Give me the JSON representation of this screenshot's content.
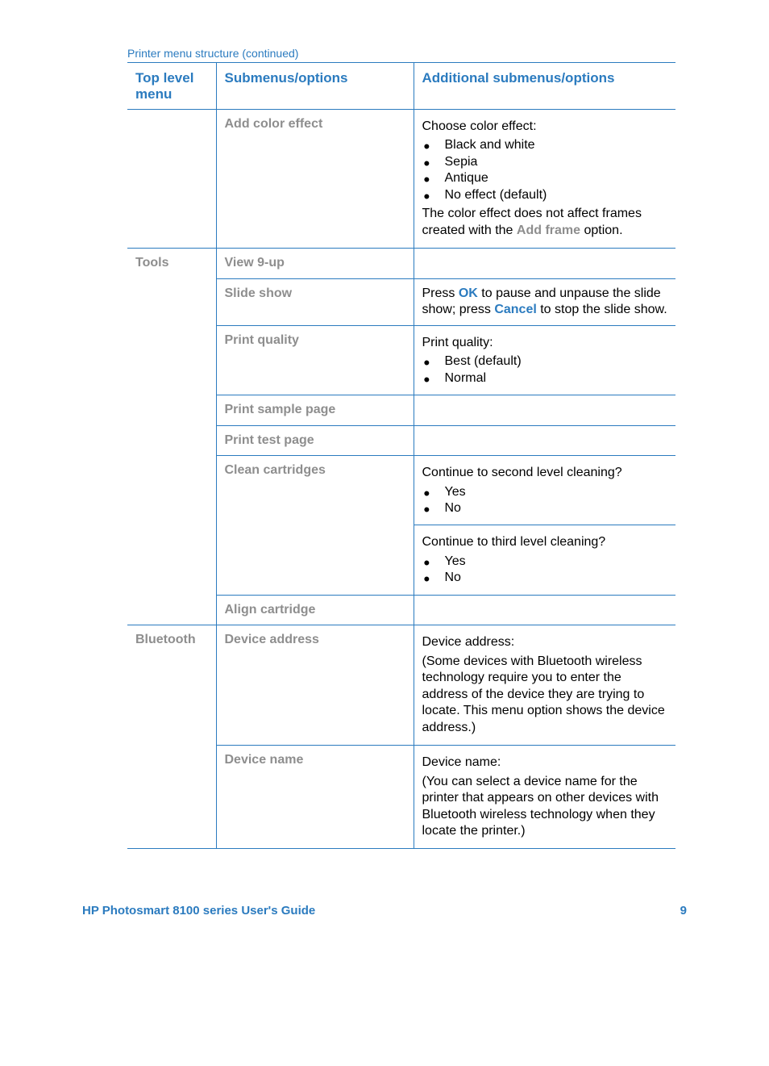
{
  "caption": "Printer menu structure (continued)",
  "headers": {
    "c1": "Top level menu",
    "c2": "Submenus/options",
    "c3": "Additional submenus/options"
  },
  "row_add_color_effect": {
    "sub": "Add color effect",
    "lead": "Choose color effect:",
    "bullets": {
      "b1": "Black and white",
      "b2": "Sepia",
      "b3": "Antique",
      "b4": "No effect (default)"
    },
    "trail_a": "The color effect does not affect frames created with the ",
    "trail_b": "Add frame",
    "trail_c": " option."
  },
  "row_tools": {
    "top": "Tools",
    "sub": "View 9-up"
  },
  "row_slide_show": {
    "sub": "Slide show",
    "t1": "Press ",
    "ok": "OK",
    "t2": " to pause and unpause the slide show; press ",
    "cancel": "Cancel",
    "t3": " to stop the slide show."
  },
  "row_print_quality": {
    "sub": "Print quality",
    "lead": "Print quality:",
    "b1": "Best (default)",
    "b2": "Normal"
  },
  "row_print_sample_page": {
    "sub": "Print sample page"
  },
  "row_print_test_page": {
    "sub": "Print test page"
  },
  "row_clean_a": {
    "sub": "Clean cartridges",
    "lead": "Continue to second level cleaning?",
    "b1": "Yes",
    "b2": "No"
  },
  "row_clean_b": {
    "lead": "Continue to third level cleaning?",
    "b1": "Yes",
    "b2": "No"
  },
  "row_align_cartridge": {
    "sub": "Align cartridge"
  },
  "row_bluetooth_addr": {
    "top": "Bluetooth",
    "sub": "Device address",
    "lead": "Device address:",
    "body": "(Some devices with Bluetooth wireless technology require you to enter the address of the device they are trying to locate. This menu option shows the device address.)"
  },
  "row_device_name": {
    "sub": "Device name",
    "lead": "Device name:",
    "body": "(You can select a device name for the printer that appears on other devices with Bluetooth wireless technology when they locate the printer.)"
  },
  "footer": {
    "title": "HP Photosmart 8100 series User's Guide",
    "page": "9"
  }
}
